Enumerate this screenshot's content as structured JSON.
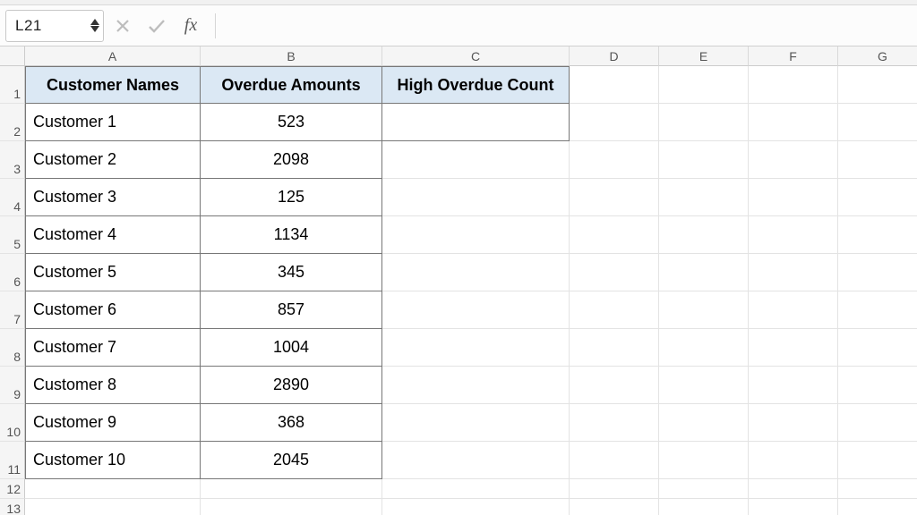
{
  "name_box": "L21",
  "formula_bar": {
    "fx_label": "fx",
    "value": ""
  },
  "columns": [
    "A",
    "B",
    "C",
    "D",
    "E",
    "F",
    "G"
  ],
  "rows": [
    "1",
    "2",
    "3",
    "4",
    "5",
    "6",
    "7",
    "8",
    "9",
    "10",
    "11",
    "12",
    "13"
  ],
  "table": {
    "headers": {
      "a": "Customer Names",
      "b": "Overdue Amounts",
      "c": "High Overdue Count"
    },
    "data": [
      {
        "name": "Customer 1",
        "amount": "523"
      },
      {
        "name": "Customer 2",
        "amount": "2098"
      },
      {
        "name": "Customer 3",
        "amount": "125"
      },
      {
        "name": "Customer 4",
        "amount": "1134"
      },
      {
        "name": "Customer 5",
        "amount": "345"
      },
      {
        "name": "Customer 6",
        "amount": "857"
      },
      {
        "name": "Customer 7",
        "amount": "1004"
      },
      {
        "name": "Customer 8",
        "amount": "2890"
      },
      {
        "name": "Customer 9",
        "amount": "368"
      },
      {
        "name": "Customer 10",
        "amount": "2045"
      }
    ]
  }
}
